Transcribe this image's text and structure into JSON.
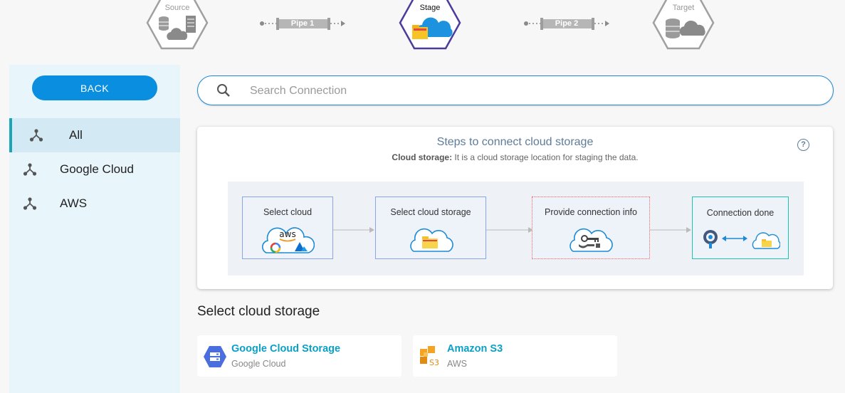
{
  "pipeline": {
    "source_label": "Source",
    "pipe1_label": "Pipe 1",
    "stage_label": "Stage",
    "pipe2_label": "Pipe 2",
    "target_label": "Target",
    "active_color": "#4b3b9c",
    "inactive_color": "#9e9e9e"
  },
  "sidebar": {
    "back_label": "BACK",
    "items": [
      {
        "label": "All",
        "icon": "connection-icon",
        "active": true
      },
      {
        "label": "Google Cloud",
        "icon": "connection-icon",
        "active": false
      },
      {
        "label": "AWS",
        "icon": "connection-icon",
        "active": false
      }
    ]
  },
  "search": {
    "placeholder": "Search Connection",
    "value": ""
  },
  "steps_card": {
    "title": "Steps to connect cloud storage",
    "subtitle_bold": "Cloud storage:",
    "subtitle_text": " It is a cloud storage location for staging the data.",
    "help_glyph": "?",
    "steps": [
      {
        "label": "Select cloud",
        "border": "#8aa6e6"
      },
      {
        "label": "Select cloud storage",
        "border": "#8aa6e6"
      },
      {
        "label": "Provide connection info",
        "border": "#f06060"
      },
      {
        "label": "Connection done",
        "border": "#1cc5b0"
      }
    ],
    "aws_text": "aws"
  },
  "select_section": {
    "title": "Select cloud storage",
    "tiles": [
      {
        "name": "Google Cloud Storage",
        "provider": "Google Cloud",
        "icon": "gcs-icon"
      },
      {
        "name": "Amazon S3",
        "provider": "AWS",
        "icon": "s3-icon",
        "icon_text": "S3"
      }
    ]
  },
  "colors": {
    "accent": "#0a8ee0",
    "link": "#0aa0c4",
    "sidebar_bg": "#e8f6fc"
  }
}
